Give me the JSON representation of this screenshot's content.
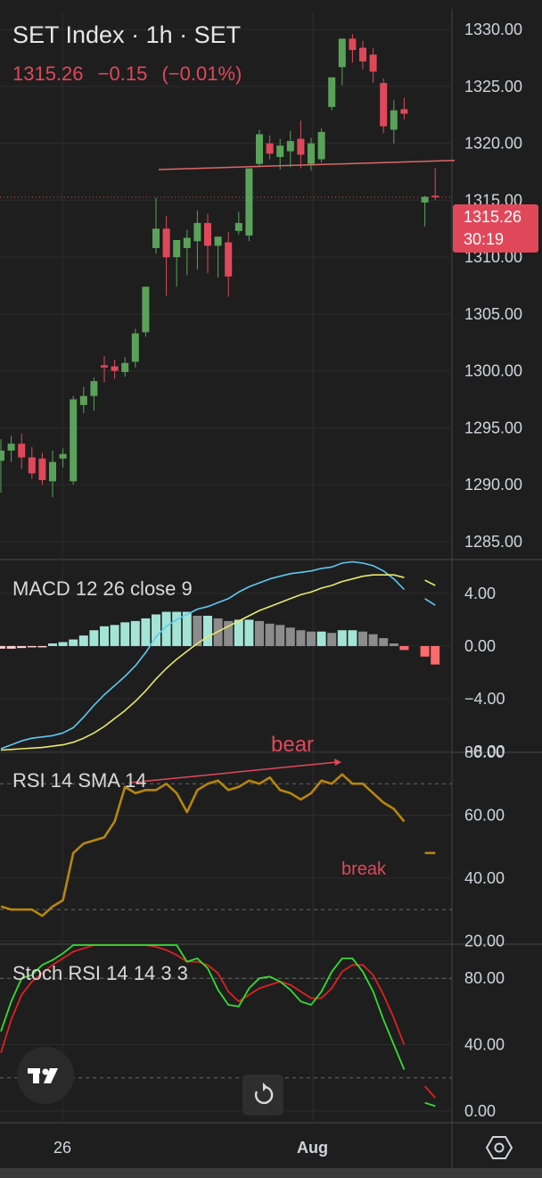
{
  "header": {
    "title": "SET Index · 1h · SET",
    "last_price": "1315.26",
    "change": "−0.15",
    "change_pct": "(−0.01%)"
  },
  "price_tag": {
    "price": "1315.26",
    "countdown": "30:19"
  },
  "colors": {
    "background": "#1e1e1e",
    "up": "#5aa25a",
    "down": "#e0485a",
    "macd_line": "#5ec8f2",
    "signal_line": "#e8e86a",
    "hist_pos_grow": "#a3e4d7",
    "hist_pos_fall": "#8c8c8c",
    "hist_neg": "#ff6b6b",
    "rsi_line": "#b8860b",
    "stoch_k": "#33dd33",
    "stoch_d": "#dd2222"
  },
  "icons": {
    "logo": "tradingview-logo-icon",
    "reset": "reset-chart-icon",
    "settings": "settings-hexagon-icon"
  },
  "chart_data": [
    {
      "type": "candlestick",
      "name": "price",
      "title": "SET Index · 1h · SET",
      "y_ticks": [
        "1330.00",
        "1325.00",
        "1320.00",
        "1315.00",
        "1310.00",
        "1305.00",
        "1300.00",
        "1295.00",
        "1290.00",
        "1285.00"
      ],
      "ylim": [
        1283.5,
        1331.5
      ],
      "x_labels": [
        "26",
        "Aug"
      ],
      "grid": true,
      "resistance_line": [
        1317.7,
        1318.5
      ],
      "candles": [
        [
          1292.1,
          1294.0,
          1289.3,
          1293.0
        ],
        [
          1293.0,
          1294.3,
          1292.0,
          1293.6
        ],
        [
          1293.6,
          1294.5,
          1291.4,
          1292.4
        ],
        [
          1292.4,
          1293.3,
          1290.5,
          1291.0
        ],
        [
          1292.3,
          1292.8,
          1290.0,
          1290.4
        ],
        [
          1290.3,
          1293.0,
          1288.9,
          1292.0
        ],
        [
          1292.3,
          1293.2,
          1291.5,
          1292.7
        ],
        [
          1290.3,
          1297.8,
          1290.0,
          1297.5
        ],
        [
          1297.0,
          1298.6,
          1296.3,
          1297.8
        ],
        [
          1297.8,
          1299.4,
          1296.5,
          1299.1
        ],
        [
          1300.5,
          1301.3,
          1299.0,
          1300.3
        ],
        [
          1300.4,
          1301.0,
          1299.3,
          1300.0
        ],
        [
          1299.9,
          1301.2,
          1299.5,
          1300.7
        ],
        [
          1300.8,
          1303.7,
          1300.3,
          1303.3
        ],
        [
          1303.4,
          1307.4,
          1303.0,
          1307.4
        ],
        [
          1310.8,
          1315.2,
          1310.3,
          1312.5
        ],
        [
          1312.5,
          1313.6,
          1306.6,
          1310.0
        ],
        [
          1310.0,
          1311.0,
          1307.4,
          1311.5
        ],
        [
          1310.8,
          1312.4,
          1308.4,
          1311.7
        ],
        [
          1311.4,
          1314.1,
          1308.9,
          1313.0
        ],
        [
          1313.0,
          1313.8,
          1308.6,
          1311.0
        ],
        [
          1311.0,
          1311.6,
          1308.2,
          1311.8
        ],
        [
          1311.3,
          1312.2,
          1306.5,
          1308.3
        ],
        [
          1312.3,
          1314.0,
          1312.0,
          1313.0
        ],
        [
          1311.9,
          1317.8,
          1311.4,
          1317.8
        ],
        [
          1318.2,
          1321.2,
          1317.9,
          1320.8
        ],
        [
          1320.0,
          1320.7,
          1318.6,
          1319.1
        ],
        [
          1318.8,
          1320.4,
          1317.7,
          1319.8
        ],
        [
          1319.3,
          1321.1,
          1317.9,
          1320.2
        ],
        [
          1320.4,
          1322.0,
          1317.8,
          1319.0
        ],
        [
          1318.2,
          1320.5,
          1317.6,
          1320.0
        ],
        [
          1318.6,
          1321.3,
          1318.3,
          1321.0
        ],
        [
          1323.2,
          1324.9,
          1322.9,
          1325.8
        ],
        [
          1326.7,
          1328.2,
          1325.1,
          1329.2
        ],
        [
          1329.2,
          1329.6,
          1327.1,
          1328.2
        ],
        [
          1328.4,
          1329.0,
          1326.5,
          1327.2
        ],
        [
          1327.8,
          1328.4,
          1325.3,
          1326.3
        ],
        [
          1325.3,
          1325.7,
          1320.9,
          1321.5
        ],
        [
          1321.2,
          1323.8,
          1320.0,
          1322.9
        ],
        [
          1323.0,
          1324.0,
          1322.1,
          1322.6
        ],
        [
          null,
          null,
          null,
          null
        ],
        [
          1314.8,
          1315.4,
          1312.7,
          1315.3
        ],
        [
          1315.4,
          1317.8,
          1315.0,
          1315.26
        ]
      ],
      "current_price": 1315.26
    },
    {
      "type": "macd",
      "title": "MACD 12 26 close 9",
      "y_ticks": [
        "4.00",
        "0.00",
        "−4.00",
        "−8.00"
      ],
      "ylim": [
        -8.0,
        6.5
      ],
      "macd": [
        -7.8,
        -7.5,
        -7.2,
        -7.0,
        -6.9,
        -6.8,
        -6.6,
        -6.2,
        -5.4,
        -4.5,
        -3.7,
        -3.0,
        -2.3,
        -1.5,
        -0.5,
        0.7,
        1.5,
        2.0,
        2.4,
        2.8,
        3.0,
        3.3,
        3.6,
        4.1,
        4.5,
        4.8,
        5.1,
        5.3,
        5.5,
        5.6,
        5.7,
        5.9,
        6.0,
        6.3,
        6.4,
        6.3,
        6.1,
        5.7,
        5.1,
        4.3,
        null,
        3.6,
        3.1
      ],
      "signal": [
        -7.9,
        -7.85,
        -7.8,
        -7.75,
        -7.7,
        -7.6,
        -7.5,
        -7.3,
        -7.0,
        -6.6,
        -6.1,
        -5.5,
        -4.9,
        -4.2,
        -3.4,
        -2.5,
        -1.7,
        -1.0,
        -0.4,
        0.2,
        0.7,
        1.1,
        1.5,
        1.9,
        2.3,
        2.7,
        3.0,
        3.3,
        3.6,
        3.9,
        4.1,
        4.4,
        4.6,
        4.9,
        5.1,
        5.3,
        5.4,
        5.4,
        5.4,
        5.2,
        null,
        5.0,
        4.6
      ],
      "histogram": [
        -0.2,
        -0.2,
        -0.15,
        -0.1,
        -0.1,
        0.2,
        0.3,
        0.5,
        0.8,
        1.2,
        1.5,
        1.6,
        1.8,
        1.9,
        2.1,
        2.4,
        2.6,
        2.6,
        2.6,
        2.3,
        2.3,
        2.1,
        1.9,
        2.0,
        2.0,
        1.9,
        1.7,
        1.6,
        1.4,
        1.2,
        1.1,
        1.1,
        1.0,
        1.2,
        1.2,
        1.1,
        0.9,
        0.6,
        0.2,
        -0.3,
        null,
        -0.8,
        -1.4
      ]
    },
    {
      "type": "line",
      "title": "RSI 14 SMA 14",
      "y_ticks": [
        "80.00",
        "60.00",
        "40.00",
        "20.00"
      ],
      "ylim": [
        19.0,
        80.0
      ],
      "reference_lines": [
        70,
        30
      ],
      "series": [
        {
          "values": [
            31,
            30,
            30,
            30,
            28,
            31,
            33,
            48,
            51,
            52,
            53,
            58,
            69,
            67,
            68,
            68,
            70,
            67,
            61,
            68,
            70,
            71,
            68,
            69,
            71,
            70,
            72,
            68,
            67,
            65,
            67,
            71,
            70,
            73,
            70,
            70,
            67,
            64,
            62,
            58,
            null,
            48,
            48
          ]
        }
      ]
    },
    {
      "type": "line",
      "title": "Stoch RSI 14 14 3 3",
      "y_ticks": [
        "80.00",
        "40.00",
        "0.00"
      ],
      "ylim": [
        -7.0,
        100.0
      ],
      "reference_lines": [
        80,
        20
      ],
      "series": [
        {
          "values": [
            48,
            66,
            80,
            82,
            88,
            91,
            95,
            100,
            100,
            100,
            100,
            100,
            100,
            100,
            100,
            100,
            100,
            100,
            90,
            92,
            86,
            73,
            64,
            63,
            74,
            80,
            81,
            78,
            73,
            66,
            64,
            72,
            84,
            92,
            92,
            84,
            72,
            55,
            40,
            25,
            null,
            5,
            3
          ]
        },
        {
          "values": [
            35,
            55,
            70,
            78,
            83,
            88,
            92,
            96,
            98,
            100,
            100,
            100,
            100,
            100,
            100,
            99,
            97,
            94,
            90,
            90,
            88,
            83,
            72,
            66,
            70,
            74,
            76,
            78,
            76,
            72,
            68,
            68,
            74,
            84,
            88,
            88,
            82,
            70,
            56,
            40,
            null,
            15,
            8
          ]
        }
      ]
    }
  ],
  "annotations": {
    "bear": "bear",
    "break": "break"
  }
}
